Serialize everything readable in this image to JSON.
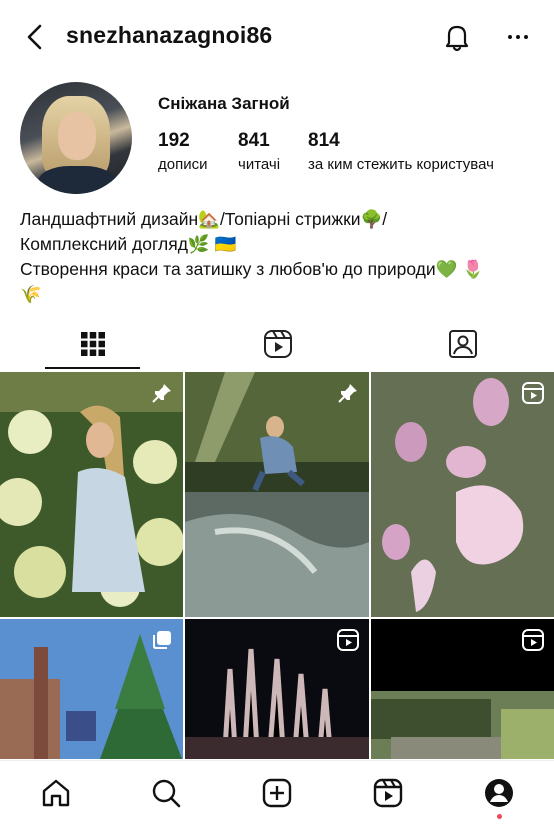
{
  "header": {
    "username": "snezhanazagnoi86",
    "back_icon": "back-arrow-icon",
    "notifications_icon": "bell-icon",
    "more_icon": "more-dots-icon"
  },
  "profile": {
    "display_name": "Сніжана Загной",
    "stats": [
      {
        "value": "192",
        "label": "дописи"
      },
      {
        "value": "841",
        "label": "читачі"
      },
      {
        "value": "814",
        "label": "за ким стежить користувач"
      }
    ],
    "bio_lines": [
      "Ландшафтний дизайн🏡/Топіарні стрижки🌳/",
      "Комплексний догляд🌿 🇺🇦",
      "Створення краси та затишку з любов'ю до природи💚 🌷",
      "🌾"
    ]
  },
  "tabs": [
    {
      "name": "grid",
      "icon": "grid-icon",
      "active": true
    },
    {
      "name": "reels",
      "icon": "reels-icon",
      "active": false
    },
    {
      "name": "tagged",
      "icon": "tagged-icon",
      "active": false
    }
  ],
  "posts": [
    {
      "subject": "woman with hydrangeas",
      "badge": "pin-icon"
    },
    {
      "subject": "woman by forest stream",
      "badge": "pin-icon"
    },
    {
      "subject": "pink flowers close-up",
      "badge": "reel-icon"
    },
    {
      "subject": "fir tree and chimney",
      "badge": "carousel-icon"
    },
    {
      "subject": "night fountain",
      "badge": "reel-icon"
    },
    {
      "subject": "garden path",
      "badge": "reel-icon"
    }
  ],
  "bottom_nav": [
    "home-icon",
    "search-icon",
    "create-icon",
    "reels-icon",
    "profile-icon"
  ],
  "colors": {
    "text": "#111111",
    "notification_dot": "#ed4956",
    "background": "#ffffff"
  }
}
